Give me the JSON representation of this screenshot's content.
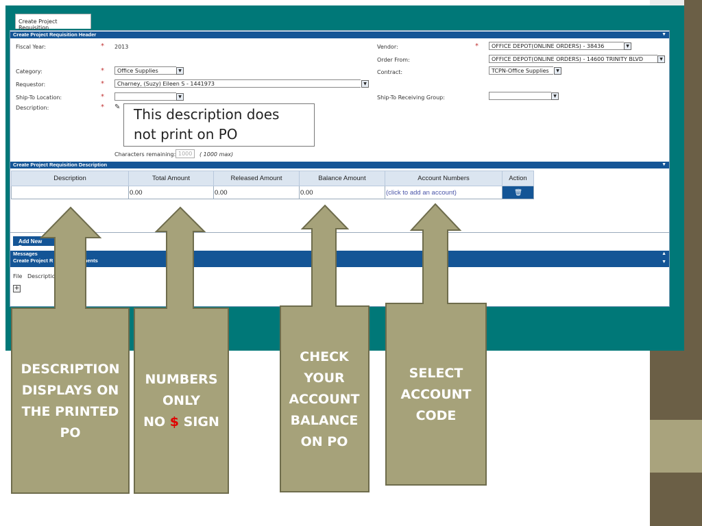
{
  "tab": "Create Project Requisition",
  "header": {
    "title": "Create Project Requisition Header",
    "fiscal_year_label": "Fiscal Year:",
    "fiscal_year": "2013",
    "category_label": "Category:",
    "category": "Office Supplies",
    "requestor_label": "Requestor:",
    "requestor": "Charney, (Suzy) Eileen S - 1441973",
    "ship_to_label": "Ship-To Location:",
    "ship_to": "",
    "description_label": "Description:",
    "description": "This description does not print on PO",
    "chars_label": "Characters remaining:",
    "chars": "1000",
    "chars_max": "( 1000 max)",
    "vendor_label": "Vendor:",
    "vendor": "OFFICE DEPOT(ONLINE ORDERS) - 38436",
    "order_from_label": "Order From:",
    "order_from": "OFFICE DEPOT(ONLINE ORDERS) - 14600 TRINITY BLVD",
    "contract_label": "Contract:",
    "contract": "TCPN-Office Supplies",
    "receiving_label": "Ship-To Receiving Group:",
    "receiving": ""
  },
  "desc_section": {
    "title": "Create Project Requisition Description",
    "columns": [
      "Description",
      "Total Amount",
      "Released Amount",
      "Balance Amount",
      "Account Numbers",
      "Action"
    ],
    "row": [
      "",
      "0.00",
      "0.00",
      "0.00",
      "(click to add an account)"
    ],
    "add_button": "Add New Desc"
  },
  "messages": "Messages",
  "attachments": {
    "title": "Create Project R",
    "title2": "Attachments",
    "file": "File",
    "description": "Descriptio"
  },
  "callouts": [
    "DESCRIPTION DISPLAYS ON THE PRINTED PO",
    "NUMBERS ONLY",
    "NO",
    "$",
    "SIGN",
    "CHECK YOUR ACCOUNT BALANCE ON  PO",
    "SELECT ACCOUNT CODE"
  ],
  "colors": {
    "teal": "#007878",
    "bar": "#145596",
    "arrow": "#a6a27a",
    "dollar": "#e00000"
  }
}
